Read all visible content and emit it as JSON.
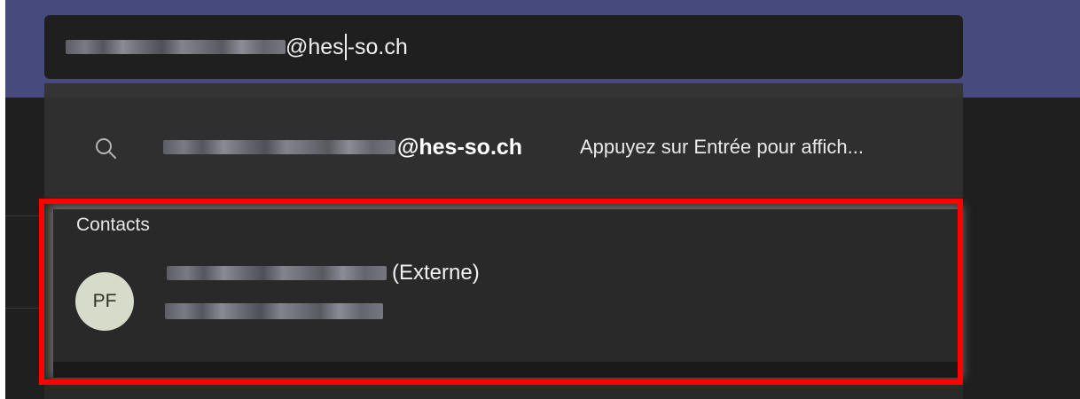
{
  "search": {
    "domain_suffix_before_caret": "@hes",
    "domain_suffix_after_caret": "-so.ch"
  },
  "suggestion": {
    "email_domain": "@hes-so.ch",
    "hint": "Appuyez sur Entrée pour affich..."
  },
  "contacts": {
    "section_title": "Contacts",
    "items": [
      {
        "initials": "PF",
        "name_suffix": "(Externe)"
      }
    ]
  },
  "colors": {
    "top_bar": "#474a7c",
    "highlight": "#ff0000",
    "avatar_bg": "#d7dbc9"
  },
  "icons": {
    "search": "search-icon"
  }
}
